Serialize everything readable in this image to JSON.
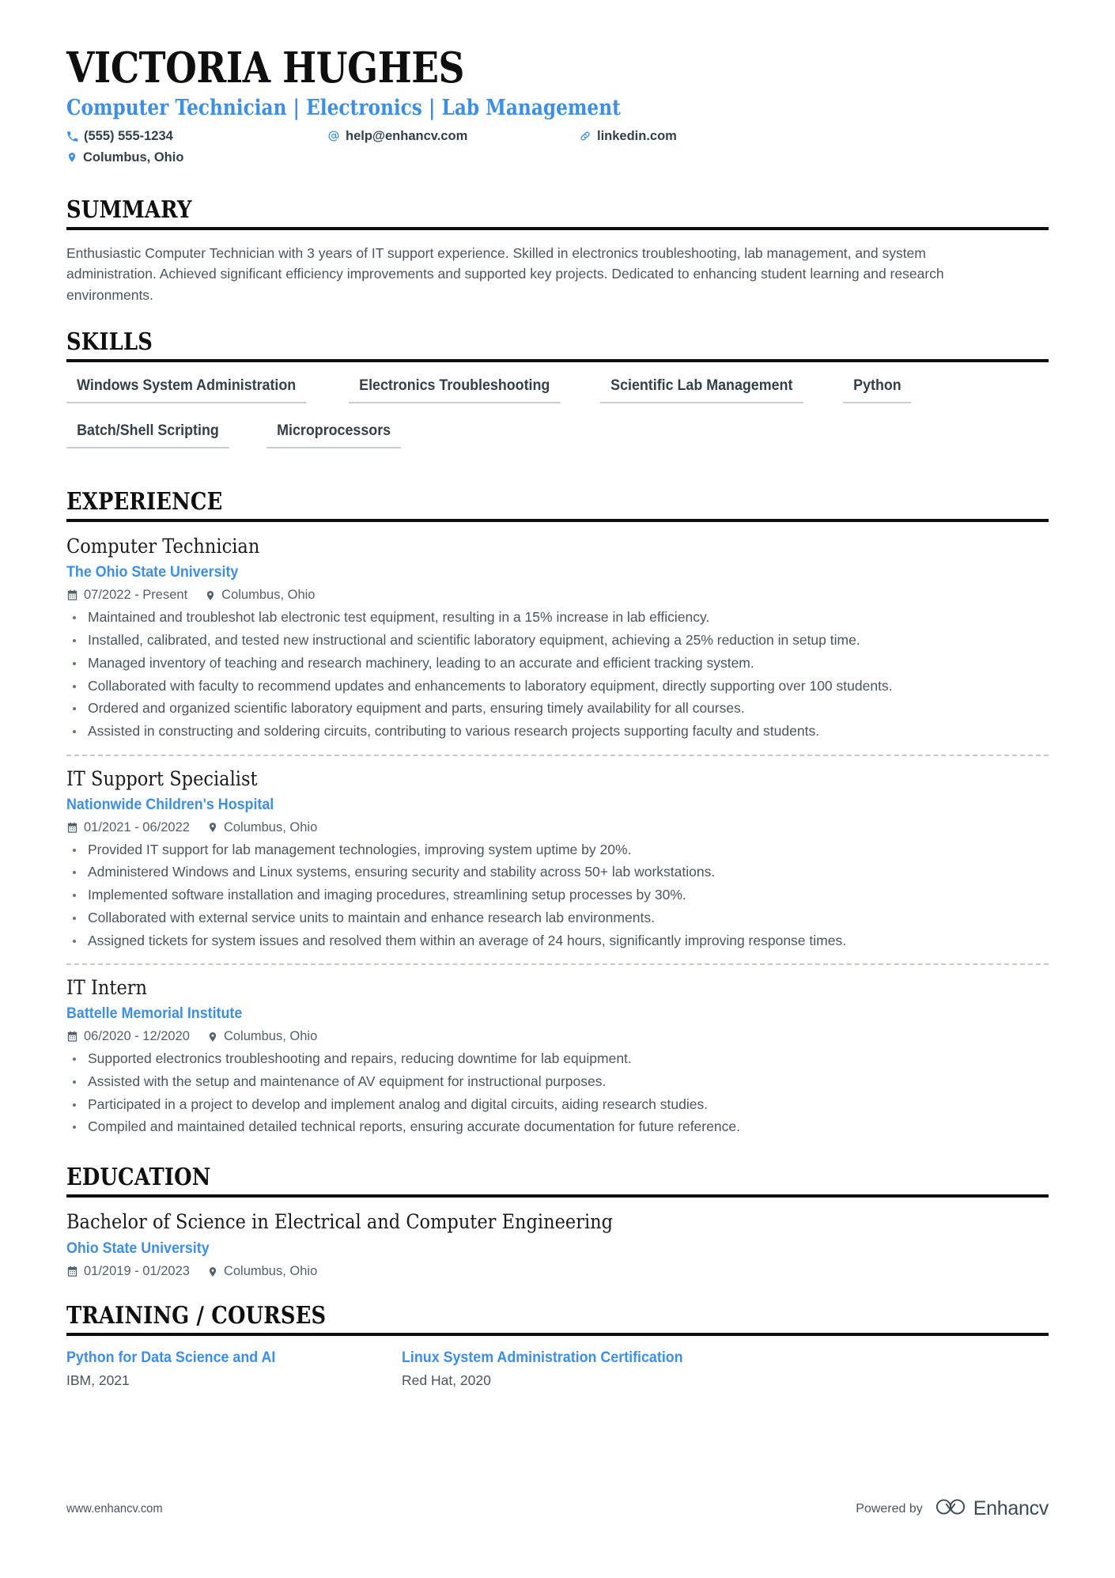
{
  "header": {
    "name": "VICTORIA HUGHES",
    "headline": "Computer Technician | Electronics | Lab Management",
    "contacts": {
      "phone": "(555) 555-1234",
      "email": "help@enhancv.com",
      "link": "linkedin.com",
      "location": "Columbus, Ohio"
    }
  },
  "sections": {
    "summary": {
      "title": "SUMMARY",
      "text": "Enthusiastic Computer Technician with 3 years of IT support experience. Skilled in electronics troubleshooting, lab management, and system administration. Achieved significant efficiency improvements and supported key projects. Dedicated to enhancing student learning and research environments."
    },
    "skills": {
      "title": "SKILLS",
      "items": [
        "Windows System Administration",
        "Electronics Troubleshooting",
        "Scientific Lab Management",
        "Python",
        "Batch/Shell Scripting",
        "Microprocessors"
      ]
    },
    "experience": {
      "title": "EXPERIENCE",
      "jobs": [
        {
          "title": "Computer Technician",
          "company": "The Ohio State University",
          "dates": "07/2022 - Present",
          "location": "Columbus, Ohio",
          "bullets": [
            "Maintained and troubleshot lab electronic test equipment, resulting in a 15% increase in lab efficiency.",
            "Installed, calibrated, and tested new instructional and scientific laboratory equipment, achieving a 25% reduction in setup time.",
            "Managed inventory of teaching and research machinery, leading to an accurate and efficient tracking system.",
            "Collaborated with faculty to recommend updates and enhancements to laboratory equipment, directly supporting over 100 students.",
            "Ordered and organized scientific laboratory equipment and parts, ensuring timely availability for all courses.",
            "Assisted in constructing and soldering circuits, contributing to various research projects supporting faculty and students."
          ]
        },
        {
          "title": "IT Support Specialist",
          "company": "Nationwide Children's Hospital",
          "dates": "01/2021 - 06/2022",
          "location": "Columbus, Ohio",
          "bullets": [
            "Provided IT support for lab management technologies, improving system uptime by 20%.",
            "Administered Windows and Linux systems, ensuring security and stability across 50+ lab workstations.",
            "Implemented software installation and imaging procedures, streamlining setup processes by 30%.",
            "Collaborated with external service units to maintain and enhance research lab environments.",
            "Assigned tickets for system issues and resolved them within an average of 24 hours, significantly improving response times."
          ]
        },
        {
          "title": "IT Intern",
          "company": "Battelle Memorial Institute",
          "dates": "06/2020 - 12/2020",
          "location": "Columbus, Ohio",
          "bullets": [
            "Supported electronics troubleshooting and repairs, reducing downtime for lab equipment.",
            "Assisted with the setup and maintenance of AV equipment for instructional purposes.",
            "Participated in a project to develop and implement analog and digital circuits, aiding research studies.",
            "Compiled and maintained detailed technical reports, ensuring accurate documentation for future reference."
          ]
        }
      ]
    },
    "education": {
      "title": "EDUCATION",
      "entries": [
        {
          "degree": "Bachelor of Science in Electrical and Computer Engineering",
          "school": "Ohio State University",
          "dates": "01/2019 - 01/2023",
          "location": "Columbus, Ohio"
        }
      ]
    },
    "training": {
      "title": "TRAINING / COURSES",
      "courses": [
        {
          "name": "Python for Data Science and AI",
          "meta": "IBM, 2021"
        },
        {
          "name": "Linux System Administration Certification",
          "meta": "Red Hat, 2020"
        }
      ]
    }
  },
  "footer": {
    "url": "www.enhancv.com",
    "powered_by": "Powered by",
    "brand": "Enhancv"
  },
  "colors": {
    "accent": "#3b8fe8",
    "heading": "#0f0f0f",
    "body": "#4a555e",
    "rule": "#0f0f0f",
    "skill_underline": "#c9ced3"
  }
}
